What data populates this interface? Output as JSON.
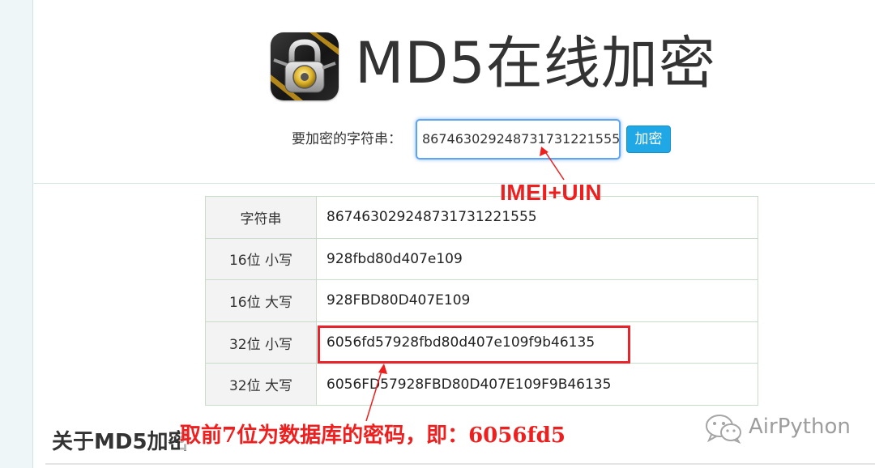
{
  "header": {
    "title": "MD5在线加密",
    "logo_icon": "padlock-icon"
  },
  "form": {
    "label": "要加密的字符串：",
    "input_value": "867463029248731731221555",
    "button_label": "加密"
  },
  "results": [
    {
      "label": "字符串",
      "value": "867463029248731731221555"
    },
    {
      "label": "16位 小写",
      "value": "928fbd80d407e109"
    },
    {
      "label": "16位 大写",
      "value": "928FBD80D407E109"
    },
    {
      "label": "32位 小写",
      "value": "6056fd57928fbd80d407e109f9b46135"
    },
    {
      "label": "32位 大写",
      "value": "6056FD57928FBD80D407E109F9B46135"
    }
  ],
  "about": {
    "title": "关于MD5加密"
  },
  "annotations": {
    "imei_uin": "IMEI+UIN",
    "note": "取前7位为数据库的密码，即：6056fd5",
    "color": "#ee1f1f"
  },
  "watermark": {
    "text": "AirPython",
    "icon": "wechat-icon"
  },
  "colors": {
    "accent": "#1fa7e6",
    "input_focus": "#5ea5f0",
    "table_border": "#c9dcc9",
    "highlight": "#e8242a"
  }
}
